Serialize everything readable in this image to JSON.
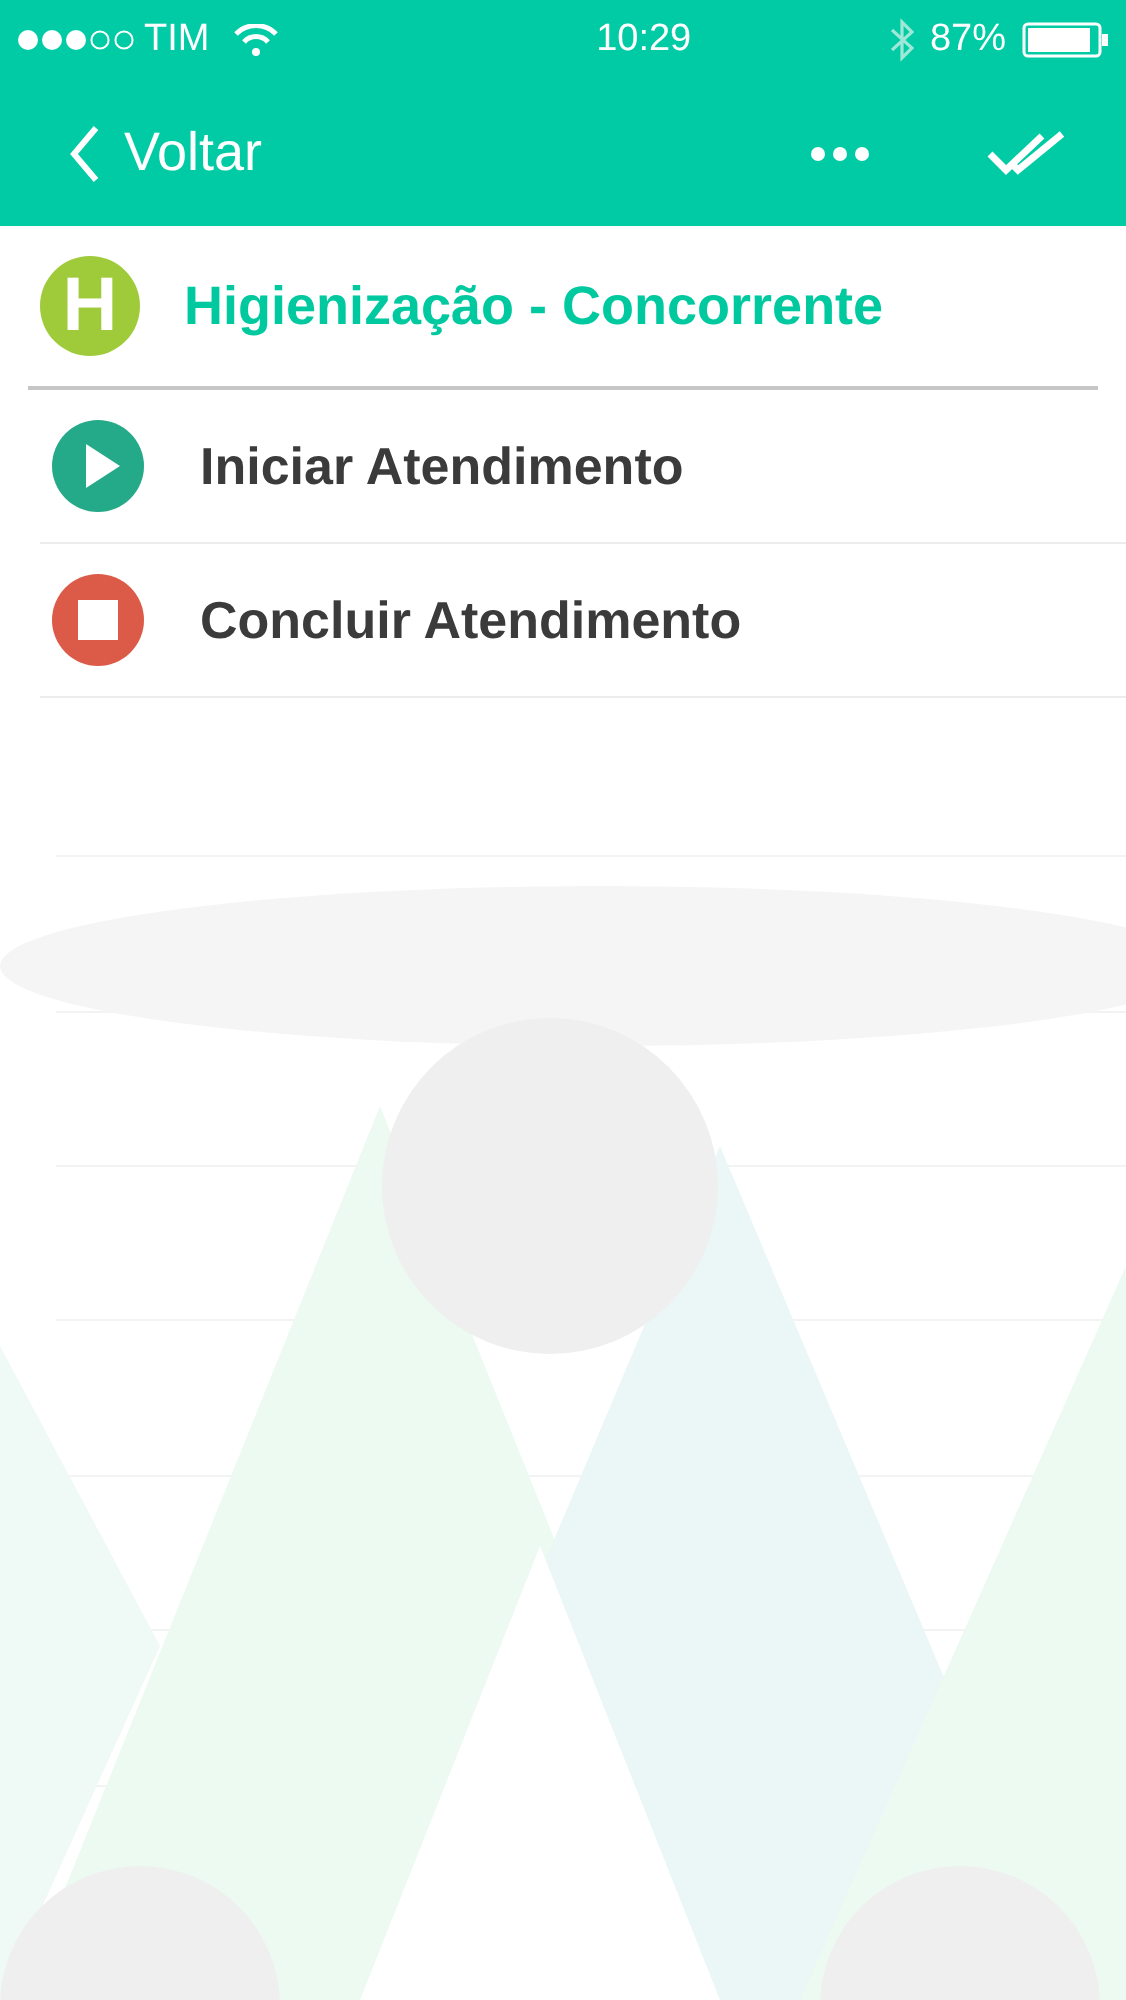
{
  "status_bar": {
    "carrier": "TIM",
    "time": "10:29",
    "battery": "87%"
  },
  "nav": {
    "back_label": "Voltar"
  },
  "header": {
    "icon_letter": "H",
    "title": "Higienização - Concorrente"
  },
  "actions": [
    {
      "kind": "start",
      "label": "Iniciar Atendimento"
    },
    {
      "kind": "stop",
      "label": "Concluir Atendimento"
    }
  ]
}
